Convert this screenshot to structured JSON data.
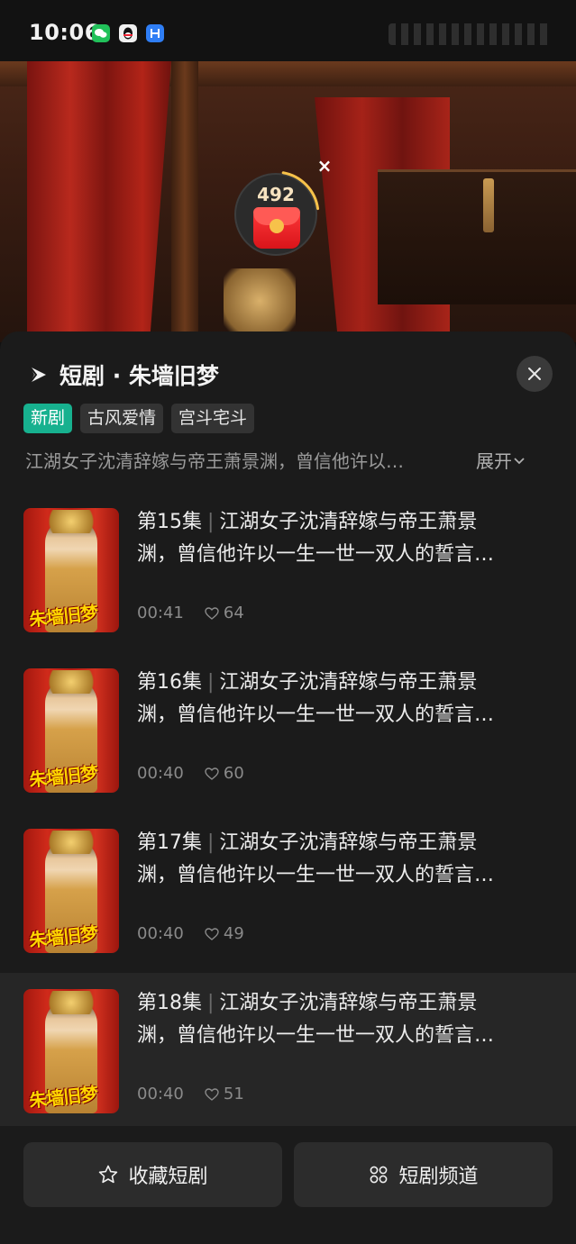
{
  "status_bar": {
    "time": "10:06",
    "notifications": [
      "wechat-icon",
      "qq-icon",
      "app-icon"
    ]
  },
  "reward": {
    "count": "492",
    "close": "×",
    "progress_fraction": 0.2
  },
  "sheet": {
    "title": "短剧 · 朱墙旧梦",
    "tags": [
      "新剧",
      "古风爱情",
      "宫斗宅斗"
    ],
    "synopsis": "江湖女子沈清辞嫁与帝王萧景渊，曾信他许以…",
    "expand_label": "展开"
  },
  "episodes": [
    {
      "label": "第15集",
      "title_line1": "江湖女子沈清辞嫁与帝王萧景",
      "title_line2": "渊，曾信他许以一生一世一双人的誓言…",
      "duration": "00:41",
      "likes": "64",
      "thumb_caption": "朱墙旧梦"
    },
    {
      "label": "第16集",
      "title_line1": "江湖女子沈清辞嫁与帝王萧景",
      "title_line2": "渊，曾信他许以一生一世一双人的誓言…",
      "duration": "00:40",
      "likes": "60",
      "thumb_caption": "朱墙旧梦"
    },
    {
      "label": "第17集",
      "title_line1": "江湖女子沈清辞嫁与帝王萧景",
      "title_line2": "渊，曾信他许以一生一世一双人的誓言…",
      "duration": "00:40",
      "likes": "49",
      "thumb_caption": "朱墙旧梦"
    },
    {
      "label": "第18集",
      "title_line1": "江湖女子沈清辞嫁与帝王萧景",
      "title_line2": "渊，曾信他许以一生一世一双人的誓言…",
      "duration": "00:40",
      "likes": "51",
      "thumb_caption": "朱墙旧梦"
    }
  ],
  "bottom": {
    "favorite_label": "收藏短剧",
    "channel_label": "短剧频道"
  },
  "colors": {
    "accent_new_tag": "#17b18f",
    "sheet_bg": "#1b1b1b",
    "active_row_bg": "#262626",
    "reward_gold": "#f7c24a"
  }
}
